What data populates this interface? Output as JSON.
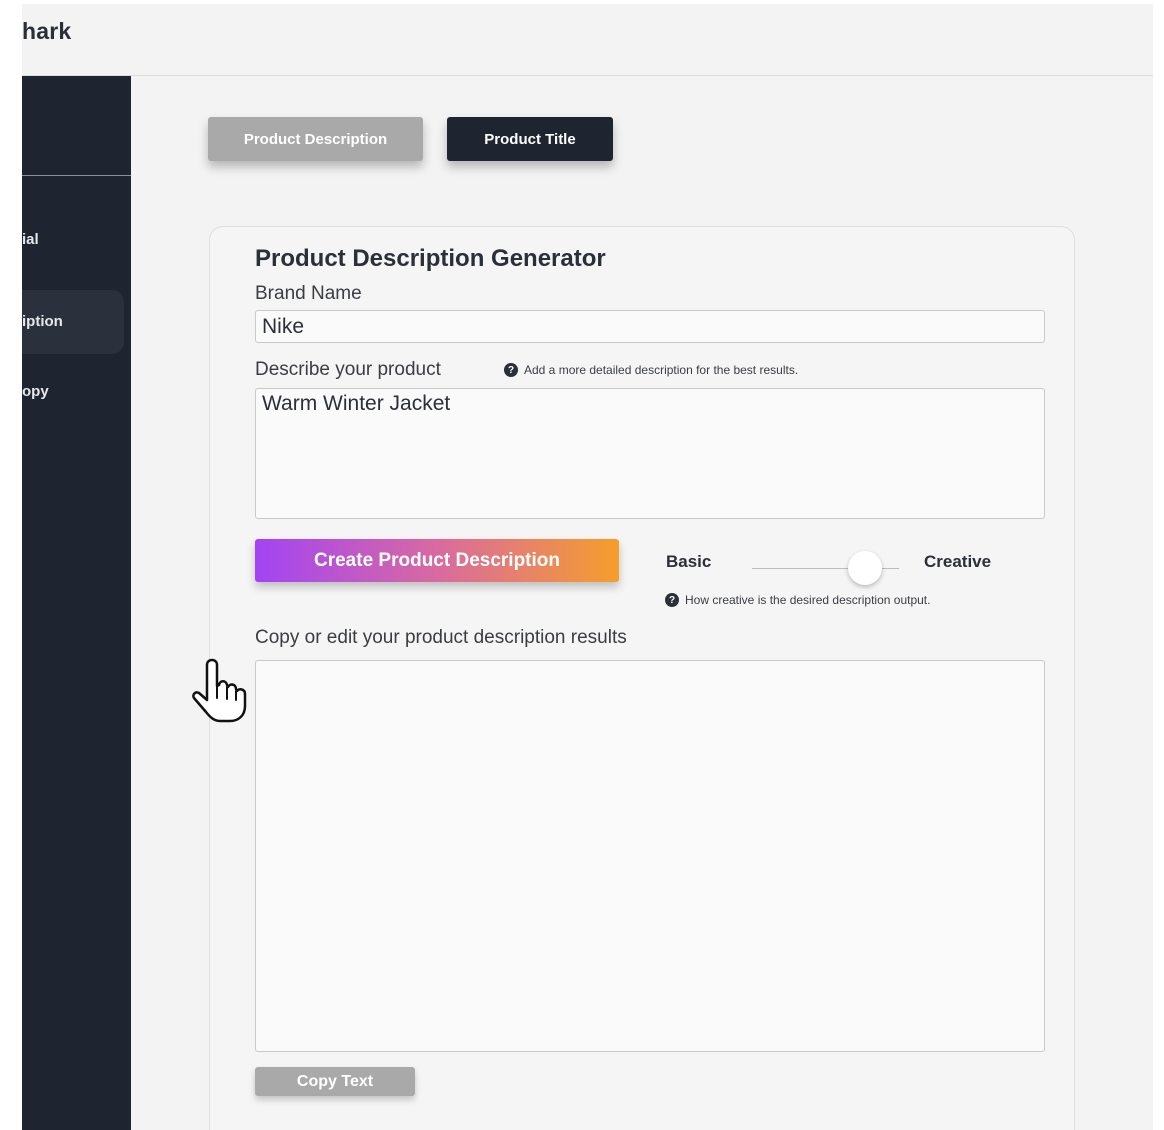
{
  "header": {
    "brand_partial": "hark"
  },
  "sidebar": {
    "items": [
      {
        "label": "ial"
      },
      {
        "label": "iption",
        "active": true
      },
      {
        "label": "opy"
      }
    ]
  },
  "tabs": [
    {
      "label": "Product Description",
      "active": true
    },
    {
      "label": "Product Title",
      "active": false
    }
  ],
  "generator": {
    "title": "Product Description Generator",
    "brand_label": "Brand Name",
    "brand_value": "Nike",
    "describe_label": "Describe your product",
    "describe_hint": "Add a more detailed description for the best results.",
    "describe_value": "Warm Winter Jacket",
    "create_button": "Create Product Description",
    "slider": {
      "min_label": "Basic",
      "max_label": "Creative",
      "value_fraction": 0.77,
      "hint": "How creative is the desired description output."
    },
    "results_label": "Copy or edit your product description results",
    "results_value": "",
    "copy_button": "Copy Text"
  },
  "colors": {
    "sidebar_bg": "#1e2530",
    "accent_gradient_start": "#a244f4",
    "accent_gradient_end": "#f59e2c",
    "inactive_button": "#a9a9a9"
  },
  "icons": {
    "help": "question-circle-icon",
    "cursor": "hand-pointer-icon"
  }
}
